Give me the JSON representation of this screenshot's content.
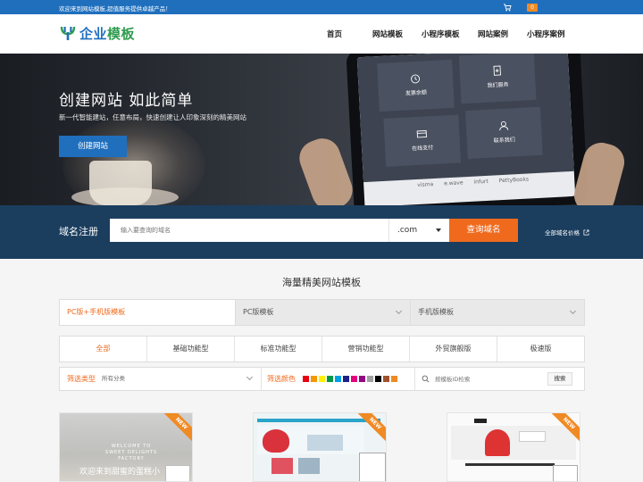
{
  "topbar": {
    "welcome": "欢迎来到网站模板,超值服务提供卓越产品！",
    "cart_count": "0"
  },
  "header": {
    "logo_part1": "企业",
    "logo_part2": "模板",
    "nav": [
      "首页",
      "网站模板",
      "小程序模板",
      "网站案例",
      "小程序案例"
    ]
  },
  "hero": {
    "title": "创建网站 如此简单",
    "subtitle": "新一代智能建站，任意布局，快速创建让人印象深刻的精美网站",
    "cta": "创建网站",
    "tablet_tiles": [
      "发票余额",
      "我们服务",
      "在线支付",
      "联系我们"
    ],
    "tablet_brands": [
      "visma",
      "e.wave",
      "",
      "infurt",
      "PettyBooks"
    ]
  },
  "domain": {
    "label": "域名注册",
    "placeholder": "输入要查询的域名",
    "tld": ".com",
    "search_button": "查询域名",
    "prices_link": "全部域名价格"
  },
  "templates": {
    "title": "海量精美网站模板",
    "selects": [
      {
        "label": "PC版+手机版模板",
        "active": true
      },
      {
        "label": "PC版模板",
        "active": false
      },
      {
        "label": "手机版模板",
        "active": false
      }
    ],
    "categories": [
      "全部",
      "基础功能型",
      "标准功能型",
      "营销功能型",
      "外贸旗舰版",
      "极速版"
    ],
    "filter_type_label": "筛选类型",
    "filter_type_value": "所有分类",
    "filter_color_label": "筛选颜色",
    "colors": [
      "#e60012",
      "#f39800",
      "#fff100",
      "#009944",
      "#00a0e9",
      "#1d2088",
      "#e4007f",
      "#920783",
      "#9fa0a0",
      "#000000",
      "#a0522d",
      "#f08a24"
    ],
    "id_search_placeholder": "按模板ID检索",
    "id_search_button": "搜索",
    "cards": [
      {
        "badge": "NEW",
        "caption": "欢迎来到甜蜜的蛋糕小",
        "small_text": "WELCOME TO SWEET DELIGHTS FACTORY"
      },
      {
        "badge": "NEW"
      },
      {
        "badge": "NEW"
      }
    ]
  }
}
